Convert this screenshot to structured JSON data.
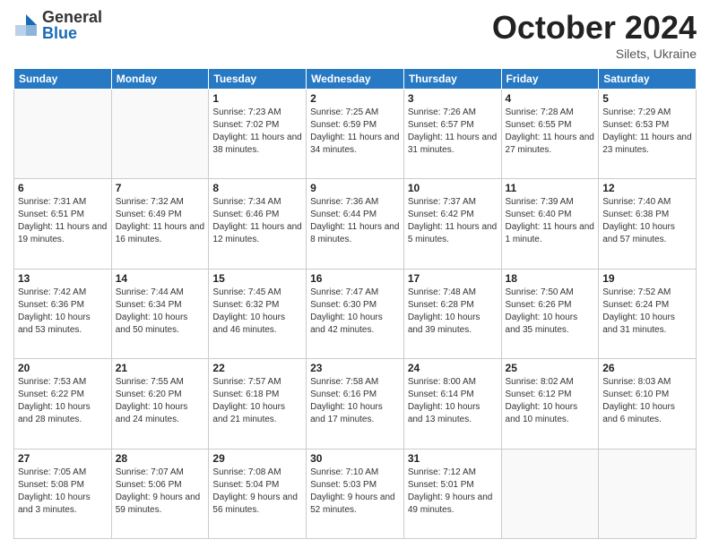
{
  "header": {
    "logo": {
      "general": "General",
      "blue": "Blue"
    },
    "month": "October 2024",
    "location": "Silets, Ukraine"
  },
  "days_of_week": [
    "Sunday",
    "Monday",
    "Tuesday",
    "Wednesday",
    "Thursday",
    "Friday",
    "Saturday"
  ],
  "weeks": [
    [
      {
        "day": "",
        "content": ""
      },
      {
        "day": "",
        "content": ""
      },
      {
        "day": "1",
        "content": "Sunrise: 7:23 AM\nSunset: 7:02 PM\nDaylight: 11 hours and 38 minutes."
      },
      {
        "day": "2",
        "content": "Sunrise: 7:25 AM\nSunset: 6:59 PM\nDaylight: 11 hours and 34 minutes."
      },
      {
        "day": "3",
        "content": "Sunrise: 7:26 AM\nSunset: 6:57 PM\nDaylight: 11 hours and 31 minutes."
      },
      {
        "day": "4",
        "content": "Sunrise: 7:28 AM\nSunset: 6:55 PM\nDaylight: 11 hours and 27 minutes."
      },
      {
        "day": "5",
        "content": "Sunrise: 7:29 AM\nSunset: 6:53 PM\nDaylight: 11 hours and 23 minutes."
      }
    ],
    [
      {
        "day": "6",
        "content": "Sunrise: 7:31 AM\nSunset: 6:51 PM\nDaylight: 11 hours and 19 minutes."
      },
      {
        "day": "7",
        "content": "Sunrise: 7:32 AM\nSunset: 6:49 PM\nDaylight: 11 hours and 16 minutes."
      },
      {
        "day": "8",
        "content": "Sunrise: 7:34 AM\nSunset: 6:46 PM\nDaylight: 11 hours and 12 minutes."
      },
      {
        "day": "9",
        "content": "Sunrise: 7:36 AM\nSunset: 6:44 PM\nDaylight: 11 hours and 8 minutes."
      },
      {
        "day": "10",
        "content": "Sunrise: 7:37 AM\nSunset: 6:42 PM\nDaylight: 11 hours and 5 minutes."
      },
      {
        "day": "11",
        "content": "Sunrise: 7:39 AM\nSunset: 6:40 PM\nDaylight: 11 hours and 1 minute."
      },
      {
        "day": "12",
        "content": "Sunrise: 7:40 AM\nSunset: 6:38 PM\nDaylight: 10 hours and 57 minutes."
      }
    ],
    [
      {
        "day": "13",
        "content": "Sunrise: 7:42 AM\nSunset: 6:36 PM\nDaylight: 10 hours and 53 minutes."
      },
      {
        "day": "14",
        "content": "Sunrise: 7:44 AM\nSunset: 6:34 PM\nDaylight: 10 hours and 50 minutes."
      },
      {
        "day": "15",
        "content": "Sunrise: 7:45 AM\nSunset: 6:32 PM\nDaylight: 10 hours and 46 minutes."
      },
      {
        "day": "16",
        "content": "Sunrise: 7:47 AM\nSunset: 6:30 PM\nDaylight: 10 hours and 42 minutes."
      },
      {
        "day": "17",
        "content": "Sunrise: 7:48 AM\nSunset: 6:28 PM\nDaylight: 10 hours and 39 minutes."
      },
      {
        "day": "18",
        "content": "Sunrise: 7:50 AM\nSunset: 6:26 PM\nDaylight: 10 hours and 35 minutes."
      },
      {
        "day": "19",
        "content": "Sunrise: 7:52 AM\nSunset: 6:24 PM\nDaylight: 10 hours and 31 minutes."
      }
    ],
    [
      {
        "day": "20",
        "content": "Sunrise: 7:53 AM\nSunset: 6:22 PM\nDaylight: 10 hours and 28 minutes."
      },
      {
        "day": "21",
        "content": "Sunrise: 7:55 AM\nSunset: 6:20 PM\nDaylight: 10 hours and 24 minutes."
      },
      {
        "day": "22",
        "content": "Sunrise: 7:57 AM\nSunset: 6:18 PM\nDaylight: 10 hours and 21 minutes."
      },
      {
        "day": "23",
        "content": "Sunrise: 7:58 AM\nSunset: 6:16 PM\nDaylight: 10 hours and 17 minutes."
      },
      {
        "day": "24",
        "content": "Sunrise: 8:00 AM\nSunset: 6:14 PM\nDaylight: 10 hours and 13 minutes."
      },
      {
        "day": "25",
        "content": "Sunrise: 8:02 AM\nSunset: 6:12 PM\nDaylight: 10 hours and 10 minutes."
      },
      {
        "day": "26",
        "content": "Sunrise: 8:03 AM\nSunset: 6:10 PM\nDaylight: 10 hours and 6 minutes."
      }
    ],
    [
      {
        "day": "27",
        "content": "Sunrise: 7:05 AM\nSunset: 5:08 PM\nDaylight: 10 hours and 3 minutes."
      },
      {
        "day": "28",
        "content": "Sunrise: 7:07 AM\nSunset: 5:06 PM\nDaylight: 9 hours and 59 minutes."
      },
      {
        "day": "29",
        "content": "Sunrise: 7:08 AM\nSunset: 5:04 PM\nDaylight: 9 hours and 56 minutes."
      },
      {
        "day": "30",
        "content": "Sunrise: 7:10 AM\nSunset: 5:03 PM\nDaylight: 9 hours and 52 minutes."
      },
      {
        "day": "31",
        "content": "Sunrise: 7:12 AM\nSunset: 5:01 PM\nDaylight: 9 hours and 49 minutes."
      },
      {
        "day": "",
        "content": ""
      },
      {
        "day": "",
        "content": ""
      }
    ]
  ]
}
